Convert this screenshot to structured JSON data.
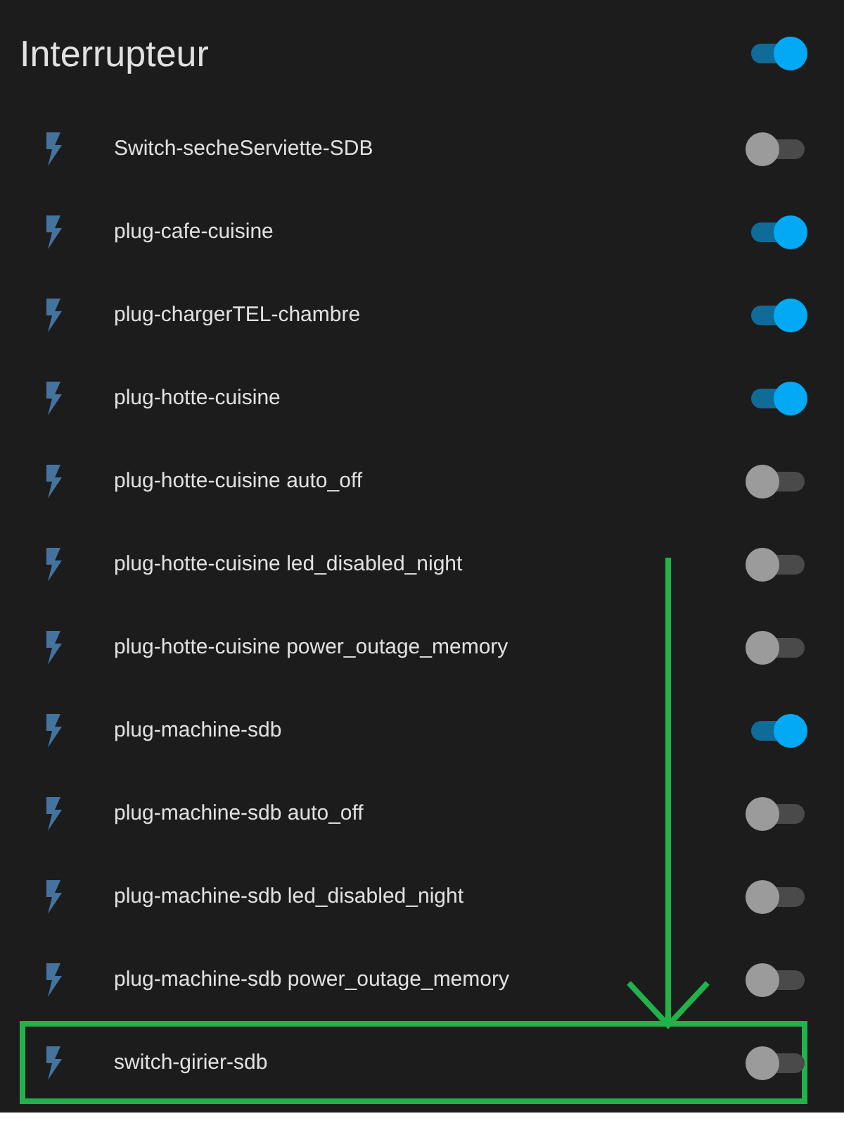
{
  "card": {
    "title": "Interrupteur",
    "master_on": true,
    "items": [
      {
        "name": "Switch-secheServiette-SDB",
        "on": false,
        "highlighted": false
      },
      {
        "name": "plug-cafe-cuisine",
        "on": true,
        "highlighted": false
      },
      {
        "name": "plug-chargerTEL-chambre",
        "on": true,
        "highlighted": false
      },
      {
        "name": "plug-hotte-cuisine",
        "on": true,
        "highlighted": false
      },
      {
        "name": "plug-hotte-cuisine auto_off",
        "on": false,
        "highlighted": false
      },
      {
        "name": "plug-hotte-cuisine led_disabled_night",
        "on": false,
        "highlighted": false
      },
      {
        "name": "plug-hotte-cuisine power_outage_memory",
        "on": false,
        "highlighted": false
      },
      {
        "name": "plug-machine-sdb",
        "on": true,
        "highlighted": false
      },
      {
        "name": "plug-machine-sdb auto_off",
        "on": false,
        "highlighted": false
      },
      {
        "name": "plug-machine-sdb led_disabled_night",
        "on": false,
        "highlighted": false
      },
      {
        "name": "plug-machine-sdb power_outage_memory",
        "on": false,
        "highlighted": false
      },
      {
        "name": "switch-girier-sdb",
        "on": false,
        "highlighted": true
      }
    ]
  }
}
